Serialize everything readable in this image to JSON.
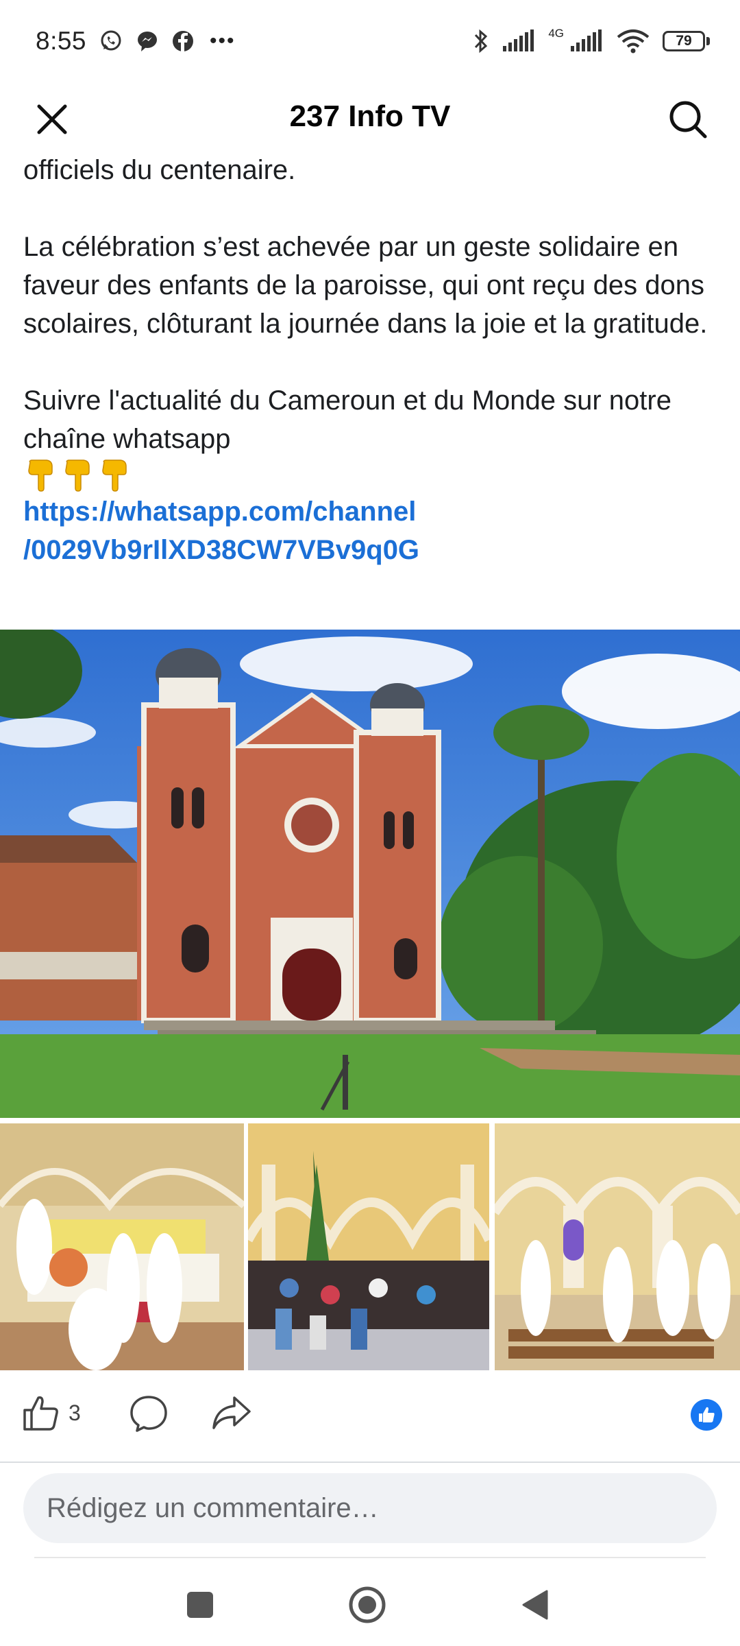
{
  "status_bar": {
    "time": "8:55",
    "more": "•••",
    "network_type": "4G",
    "battery": "79"
  },
  "header": {
    "title": "237 Info TV"
  },
  "post": {
    "paragraphs": [
      "officiels du centenaire.",
      "La célébration s’est achevée par un geste solidaire en faveur des enfants de la paroisse, qui ont reçu des dons scolaires, clôturant la journée dans la joie et la gratitude.",
      "Suivre l'actualité du Cameroun et du Monde sur notre chaîne whatsapp"
    ],
    "link_line1": "https://whatsapp.com/channel",
    "link_line2": "/0029Vb9rIlXD38CW7VBv9q0G"
  },
  "actions": {
    "like_count": "3"
  },
  "comment": {
    "placeholder": "Rédigez un commentaire…"
  },
  "colors": {
    "link": "#1b6fd6",
    "like_badge": "#1877f2",
    "input_bg": "#f0f2f5"
  }
}
